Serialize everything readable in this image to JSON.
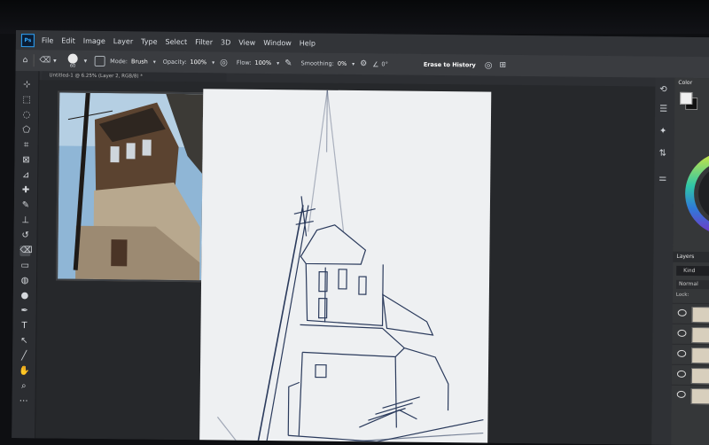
{
  "app": {
    "logo": "Ps"
  },
  "menu": [
    "File",
    "Edit",
    "Image",
    "Layer",
    "Type",
    "Select",
    "Filter",
    "3D",
    "View",
    "Window",
    "Help"
  ],
  "options": {
    "brush_size": "60",
    "mode_label": "Mode:",
    "mode_value": "Brush",
    "opacity_label": "Opacity:",
    "opacity_value": "100%",
    "flow_label": "Flow:",
    "flow_value": "100%",
    "smoothing_label": "Smoothing:",
    "smoothing_value": "0%",
    "angle_value": "0°",
    "erase_to_history": "Erase to History"
  },
  "document_tab": "Untitled-1 @ 6.25% (Layer 2, RGB/8) *",
  "panels": {
    "color_tab": "Color",
    "layers_tab": "Layers",
    "kind_label": "Kind",
    "blend_mode": "Normal",
    "lock_label": "Lock:"
  },
  "tools": [
    "move-tool",
    "marquee-tool",
    "lasso-tool",
    "quick-select-tool",
    "crop-tool",
    "frame-tool",
    "eyedropper-tool",
    "healing-tool",
    "brush-tool",
    "stamp-tool",
    "history-brush-tool",
    "eraser-tool",
    "gradient-tool",
    "blur-tool",
    "dodge-tool",
    "pen-tool",
    "type-tool",
    "path-select-tool",
    "line-tool",
    "hand-tool",
    "zoom-tool",
    "more-tool"
  ],
  "colors": {
    "accent": "#31a8ff",
    "ui_dark": "#2d2f33",
    "canvas": "#eef0f2",
    "sketch_ink": "#2a3a5c"
  }
}
